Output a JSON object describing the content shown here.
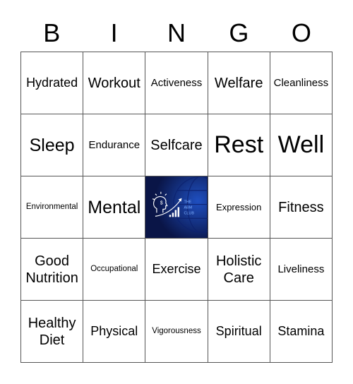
{
  "header": {
    "letters": [
      "B",
      "I",
      "N",
      "G",
      "O"
    ]
  },
  "free_space": {
    "logo_lines": [
      "THE",
      "ABM",
      "CLUB"
    ],
    "colors": {
      "background": "#0a1547",
      "accent": "#4a8cff"
    }
  },
  "cells": [
    [
      "Hydrated",
      "Workout",
      "Activeness",
      "Welfare",
      "Cleanliness"
    ],
    [
      "Sleep",
      "Endurance",
      "Selfcare",
      "Rest",
      "Well"
    ],
    [
      "Environmental",
      "Mental",
      "",
      "Expression",
      "Fitness"
    ],
    [
      "Good Nutrition",
      "Occupational",
      "Exercise",
      "Holistic Care",
      "Liveliness"
    ],
    [
      "Healthy Diet",
      "Physical",
      "Vigorousness",
      "Spiritual",
      "Stamina"
    ]
  ]
}
